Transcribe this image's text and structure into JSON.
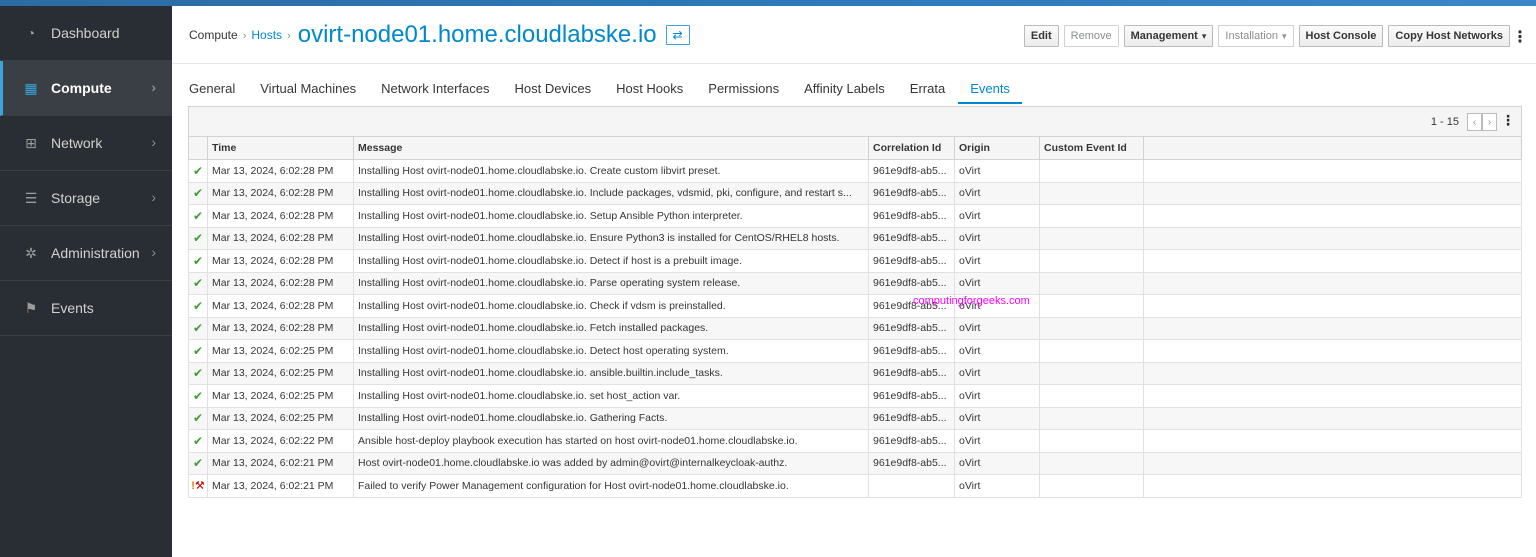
{
  "sidebar": {
    "items": [
      {
        "label": "Dashboard",
        "icon": "dashboard-icon",
        "active": false,
        "chevron": false
      },
      {
        "label": "Compute",
        "icon": "compute-icon",
        "active": true,
        "chevron": true
      },
      {
        "label": "Network",
        "icon": "network-icon",
        "active": false,
        "chevron": true
      },
      {
        "label": "Storage",
        "icon": "storage-icon",
        "active": false,
        "chevron": true
      },
      {
        "label": "Administration",
        "icon": "gear-icon",
        "active": false,
        "chevron": true
      },
      {
        "label": "Events",
        "icon": "flag-icon",
        "active": false,
        "chevron": false
      }
    ]
  },
  "header": {
    "breadcrumb_root": "Compute",
    "breadcrumb_sep": "›",
    "breadcrumb_link": "Hosts",
    "title": "ovirt-node01.home.cloudlabske.io",
    "swap_icon": "⇄",
    "buttons": {
      "edit": "Edit",
      "remove": "Remove",
      "management": "Management",
      "installation": "Installation",
      "host_console": "Host Console",
      "copy_host_networks": "Copy Host Networks"
    }
  },
  "tabs": [
    "General",
    "Virtual Machines",
    "Network Interfaces",
    "Host Devices",
    "Host Hooks",
    "Permissions",
    "Affinity Labels",
    "Errata",
    "Events"
  ],
  "active_tab": "Events",
  "pager": {
    "range": "1 - 15"
  },
  "table": {
    "columns": [
      "",
      "Time",
      "Message",
      "Correlation Id",
      "Origin",
      "Custom Event Id",
      ""
    ],
    "rows": [
      {
        "status": "ok",
        "time": "Mar 13, 2024, 6:02:28 PM",
        "message": "Installing Host ovirt-node01.home.cloudlabske.io. Create custom libvirt preset.",
        "correlation": "961e9df8-ab5...",
        "origin": "oVirt",
        "custom": ""
      },
      {
        "status": "ok",
        "time": "Mar 13, 2024, 6:02:28 PM",
        "message": "Installing Host ovirt-node01.home.cloudlabske.io. Include packages, vdsmid, pki, configure, and restart s...",
        "correlation": "961e9df8-ab5...",
        "origin": "oVirt",
        "custom": ""
      },
      {
        "status": "ok",
        "time": "Mar 13, 2024, 6:02:28 PM",
        "message": "Installing Host ovirt-node01.home.cloudlabske.io. Setup Ansible Python interpreter.",
        "correlation": "961e9df8-ab5...",
        "origin": "oVirt",
        "custom": ""
      },
      {
        "status": "ok",
        "time": "Mar 13, 2024, 6:02:28 PM",
        "message": "Installing Host ovirt-node01.home.cloudlabske.io. Ensure Python3 is installed for CentOS/RHEL8 hosts.",
        "correlation": "961e9df8-ab5...",
        "origin": "oVirt",
        "custom": ""
      },
      {
        "status": "ok",
        "time": "Mar 13, 2024, 6:02:28 PM",
        "message": "Installing Host ovirt-node01.home.cloudlabske.io. Detect if host is a prebuilt image.",
        "correlation": "961e9df8-ab5...",
        "origin": "oVirt",
        "custom": ""
      },
      {
        "status": "ok",
        "time": "Mar 13, 2024, 6:02:28 PM",
        "message": "Installing Host ovirt-node01.home.cloudlabske.io. Parse operating system release.",
        "correlation": "961e9df8-ab5...",
        "origin": "oVirt",
        "custom": ""
      },
      {
        "status": "ok",
        "time": "Mar 13, 2024, 6:02:28 PM",
        "message": "Installing Host ovirt-node01.home.cloudlabske.io. Check if vdsm is preinstalled.",
        "correlation": "961e9df8-ab5...",
        "origin": "oVirt",
        "custom": ""
      },
      {
        "status": "ok",
        "time": "Mar 13, 2024, 6:02:28 PM",
        "message": "Installing Host ovirt-node01.home.cloudlabske.io. Fetch installed packages.",
        "correlation": "961e9df8-ab5...",
        "origin": "oVirt",
        "custom": ""
      },
      {
        "status": "ok",
        "time": "Mar 13, 2024, 6:02:25 PM",
        "message": "Installing Host ovirt-node01.home.cloudlabske.io. Detect host operating system.",
        "correlation": "961e9df8-ab5...",
        "origin": "oVirt",
        "custom": ""
      },
      {
        "status": "ok",
        "time": "Mar 13, 2024, 6:02:25 PM",
        "message": "Installing Host ovirt-node01.home.cloudlabske.io. ansible.builtin.include_tasks.",
        "correlation": "961e9df8-ab5...",
        "origin": "oVirt",
        "custom": ""
      },
      {
        "status": "ok",
        "time": "Mar 13, 2024, 6:02:25 PM",
        "message": "Installing Host ovirt-node01.home.cloudlabske.io. set host_action var.",
        "correlation": "961e9df8-ab5...",
        "origin": "oVirt",
        "custom": ""
      },
      {
        "status": "ok",
        "time": "Mar 13, 2024, 6:02:25 PM",
        "message": "Installing Host ovirt-node01.home.cloudlabske.io. Gathering Facts.",
        "correlation": "961e9df8-ab5...",
        "origin": "oVirt",
        "custom": ""
      },
      {
        "status": "ok",
        "time": "Mar 13, 2024, 6:02:22 PM",
        "message": "Ansible host-deploy playbook execution has started on host ovirt-node01.home.cloudlabske.io.",
        "correlation": "961e9df8-ab5...",
        "origin": "oVirt",
        "custom": ""
      },
      {
        "status": "ok",
        "time": "Mar 13, 2024, 6:02:21 PM",
        "message": "Host ovirt-node01.home.cloudlabske.io was added by admin@ovirt@internalkeycloak-authz.",
        "correlation": "961e9df8-ab5...",
        "origin": "oVirt",
        "custom": ""
      },
      {
        "status": "warning",
        "time": "Mar 13, 2024, 6:02:21 PM",
        "message": "Failed to verify Power Management configuration for Host ovirt-node01.home.cloudlabske.io.",
        "correlation": "",
        "origin": "oVirt",
        "custom": ""
      }
    ]
  },
  "watermark": "computingforgeeks.com",
  "colors": {
    "accent": "#0088ce",
    "sidebar": "#292e34",
    "ok": "#3f9c35",
    "warn": "#ec7a08"
  }
}
